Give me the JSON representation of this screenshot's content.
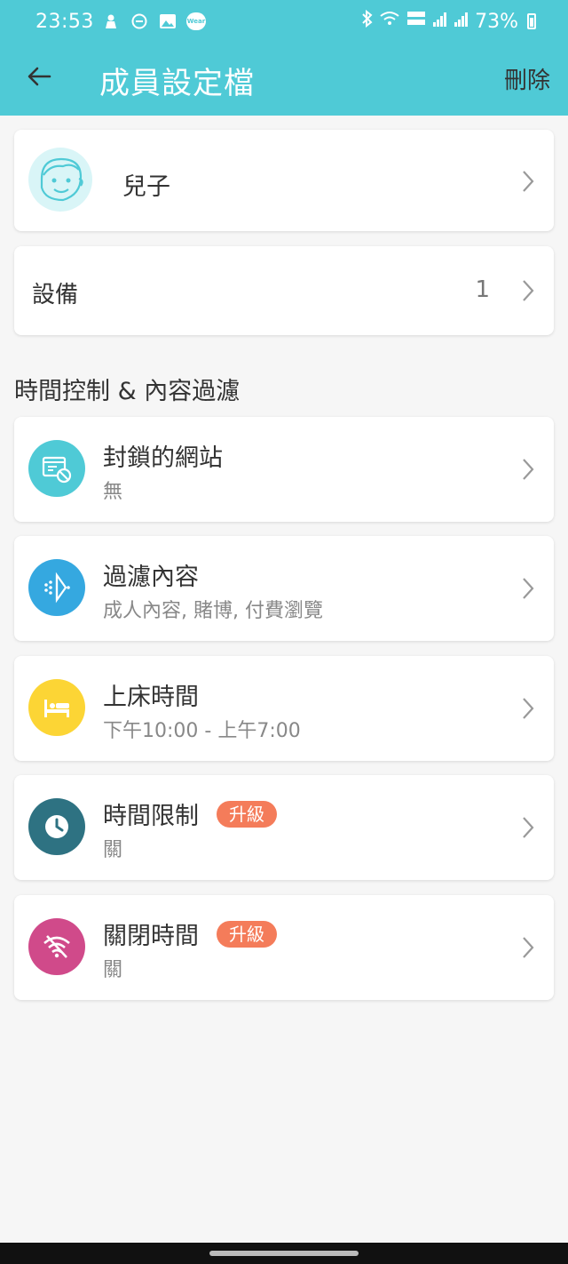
{
  "status_bar": {
    "time": "23:53",
    "wear_label": "Wear",
    "battery": "73%",
    "icons": [
      "person-icon",
      "dnd-icon",
      "image-icon",
      "wear-icon",
      "bluetooth-icon",
      "wifi-icon",
      "volte-icon",
      "signal-icon",
      "signal-roaming-icon",
      "battery-icon"
    ]
  },
  "toolbar": {
    "title": "成員設定檔",
    "delete_label": "刪除",
    "back_icon": "arrow-left-icon"
  },
  "profile": {
    "name": "兒子"
  },
  "devices": {
    "label": "設備",
    "count": "1"
  },
  "section": {
    "title": "時間控制 & 內容過濾"
  },
  "items": [
    {
      "title": "封鎖的網站",
      "subtitle": "無",
      "color": "#4fcad6",
      "icon": "blocked-site-icon",
      "badge": ""
    },
    {
      "title": "過濾內容",
      "subtitle": " 成人內容, 賭博, 付費瀏覽",
      "color": "#35a8e0",
      "icon": "filter-icon",
      "badge": ""
    },
    {
      "title": "上床時間",
      "subtitle": "下午10:00 - 上午7:00",
      "color": "#fcd535",
      "icon": "bed-icon",
      "badge": ""
    },
    {
      "title": "時間限制",
      "subtitle": "關",
      "color": "#2e7282",
      "icon": "clock-icon",
      "badge": "升級"
    },
    {
      "title": "關閉時間",
      "subtitle": "關",
      "color": "#d04a8a",
      "icon": "wifi-off-icon",
      "badge": "升級"
    }
  ]
}
